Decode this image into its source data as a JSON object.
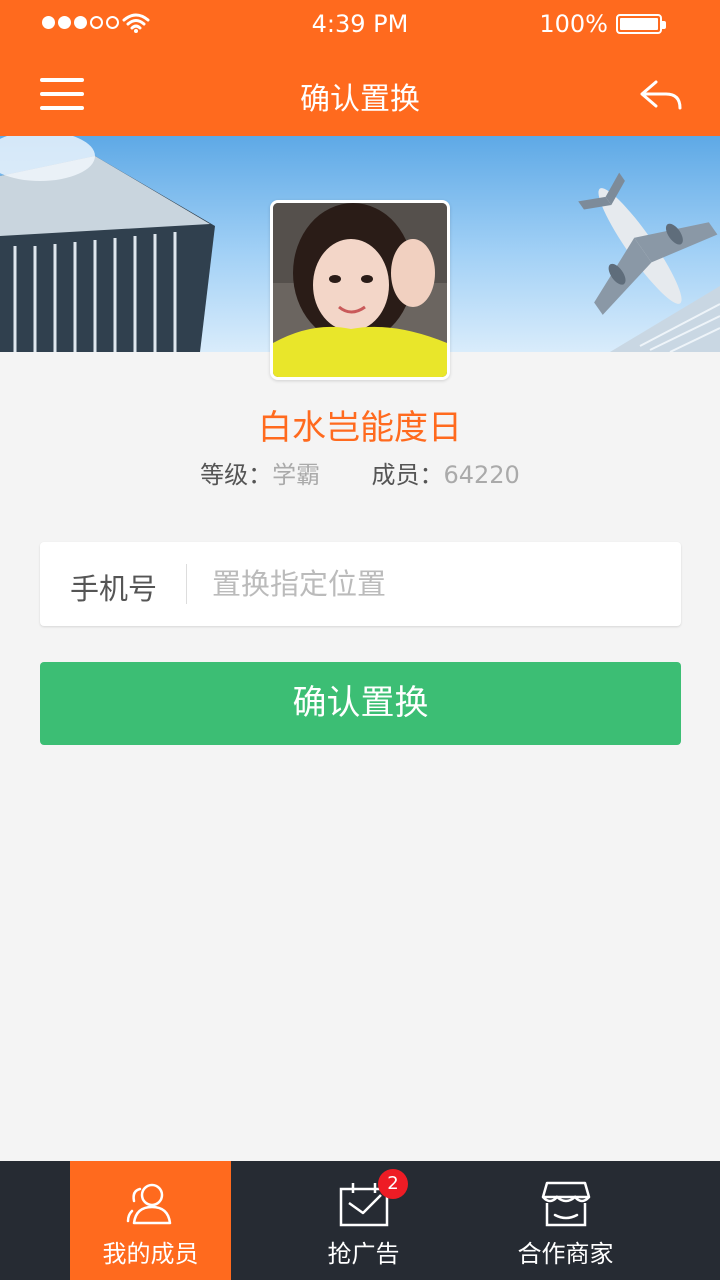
{
  "status_bar": {
    "time": "4:39 PM",
    "battery": "100%",
    "signal_bars_filled": 3,
    "signal_bars_total": 5
  },
  "nav": {
    "title": "确认置换",
    "menu_icon": "hamburger-menu-icon",
    "back_icon": "reply-arrow-icon"
  },
  "profile": {
    "name": "白水岂能度日",
    "level_label": "等级：",
    "level_value": "学霸",
    "members_label": "成员：",
    "members_value": "64220"
  },
  "form": {
    "field_label": "手机号",
    "field_placeholder": "置换指定位置",
    "field_value": "",
    "confirm_label": "确认置换"
  },
  "tabbar": {
    "tabs": [
      {
        "label": "我的成员",
        "icon": "members-icon",
        "active": true
      },
      {
        "label": "抢广告",
        "icon": "calendar-check-icon",
        "active": false,
        "badge": "2"
      },
      {
        "label": "合作商家",
        "icon": "store-icon",
        "active": false
      }
    ]
  },
  "colors": {
    "primary": "#ff6a1e",
    "confirm": "#3cbe74",
    "tabbar": "#262b33",
    "badge": "#ee1c25"
  }
}
